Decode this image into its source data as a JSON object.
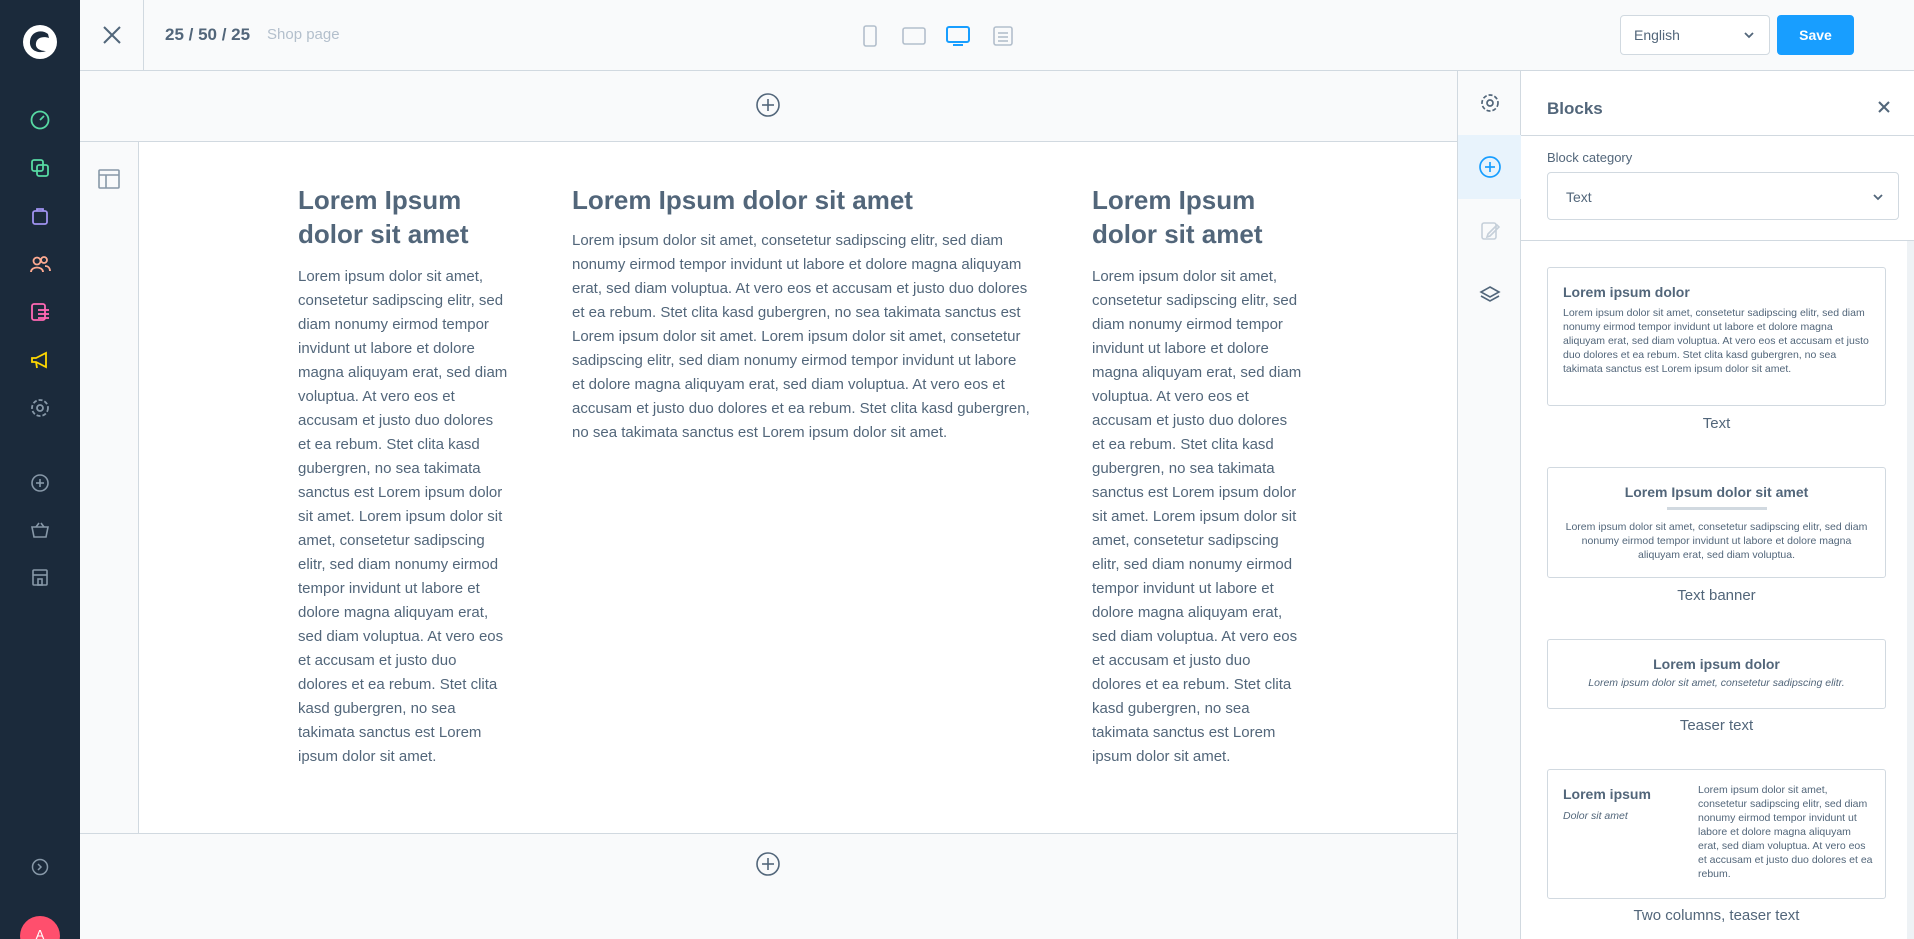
{
  "topbar": {
    "dims": "25 / 50 / 25",
    "page_name": "Shop page",
    "language": "English",
    "save_label": "Save"
  },
  "colors": {
    "sidebar_bg": "#1b2a3b",
    "accent": "#189eff",
    "dashboard": "#57d9a3",
    "catalogues": "#57d9a3",
    "orders": "#a092f0",
    "customers": "#ffab91",
    "content": "#ff68b4",
    "marketing": "#ffd700",
    "avatar": "#ff4f6d"
  },
  "admin_nav": {
    "icons": [
      "dashboard-icon",
      "catalogues-icon",
      "orders-icon",
      "customers-icon",
      "content-icon",
      "marketing-icon",
      "settings-icon",
      "add-icon",
      "basket-icon",
      "store-icon",
      "help-icon"
    ],
    "avatar_initial": "A"
  },
  "content": {
    "left": {
      "heading": "Lorem Ipsum dolor sit amet",
      "body": "Lorem ipsum dolor sit amet, consetetur sadipscing elitr, sed diam nonumy eirmod tempor invidunt ut labore et dolore magna aliquyam erat, sed diam voluptua. At vero eos et accusam et justo duo dolores et ea rebum. Stet clita kasd gubergren, no sea takimata sanctus est Lorem ipsum dolor sit amet. Lorem ipsum dolor sit amet, consetetur sadipscing elitr, sed diam nonumy eirmod tempor invidunt ut labore et dolore magna aliquyam erat, sed diam voluptua. At vero eos et accusam et justo duo dolores et ea rebum. Stet clita kasd gubergren, no sea takimata sanctus est Lorem ipsum dolor sit amet."
    },
    "center": {
      "heading": "Lorem Ipsum dolor sit amet",
      "body": "Lorem ipsum dolor sit amet, consetetur sadipscing elitr, sed diam nonumy eirmod tempor invidunt ut labore et dolore magna aliquyam erat, sed diam voluptua. At vero eos et accusam et justo duo dolores et ea rebum. Stet clita kasd gubergren, no sea takimata sanctus est Lorem ipsum dolor sit amet. Lorem ipsum dolor sit amet, consetetur sadipscing elitr, sed diam nonumy eirmod tempor invidunt ut labore et dolore magna aliquyam erat, sed diam voluptua. At vero eos et accusam et justo duo dolores et ea rebum. Stet clita kasd gubergren, no sea takimata sanctus est Lorem ipsum dolor sit amet."
    },
    "right": {
      "heading": "Lorem Ipsum dolor sit amet",
      "body": "Lorem ipsum dolor sit amet, consetetur sadipscing elitr, sed diam nonumy eirmod tempor invidunt ut labore et dolore magna aliquyam erat, sed diam voluptua. At vero eos et accusam et justo duo dolores et ea rebum. Stet clita kasd gubergren, no sea takimata sanctus est Lorem ipsum dolor sit amet. Lorem ipsum dolor sit amet, consetetur sadipscing elitr, sed diam nonumy eirmod tempor invidunt ut labore et dolore magna aliquyam erat, sed diam voluptua. At vero eos et accusam et justo duo dolores et ea rebum. Stet clita kasd gubergren, no sea takimata sanctus est Lorem ipsum dolor sit amet."
    }
  },
  "panel": {
    "title": "Blocks",
    "category_label": "Block category",
    "category_value": "Text",
    "blocks": [
      {
        "label": "Text",
        "preview_title": "Lorem ipsum dolor",
        "preview_body": "Lorem ipsum dolor sit amet, consetetur sadipscing elitr, sed diam nonumy eirmod tempor invidunt ut labore et dolore magna aliquyam erat, sed diam voluptua. At vero eos et accusam et justo duo dolores et ea rebum. Stet clita kasd gubergren, no sea takimata sanctus est Lorem ipsum dolor sit amet."
      },
      {
        "label": "Text banner",
        "preview_title": "Lorem Ipsum dolor sit amet",
        "preview_body": "Lorem ipsum dolor sit amet, consetetur sadipscing elitr, sed diam nonumy eirmod tempor invidunt ut labore et dolore magna aliquyam erat, sed diam voluptua."
      },
      {
        "label": "Teaser text",
        "preview_title": "Lorem ipsum dolor",
        "preview_body": "Lorem ipsum dolor sit amet, consetetur sadipscing elitr."
      },
      {
        "label": "Two columns, teaser text",
        "preview_title": "Lorem ipsum",
        "preview_subtitle": "Dolor sit amet",
        "preview_body": "Lorem ipsum dolor sit amet, consetetur sadipscing elitr, sed diam nonumy eirmod tempor invidunt ut labore et dolore magna aliquyam erat, sed diam voluptua. At vero eos et accusam et justo duo dolores et ea rebum."
      }
    ]
  }
}
